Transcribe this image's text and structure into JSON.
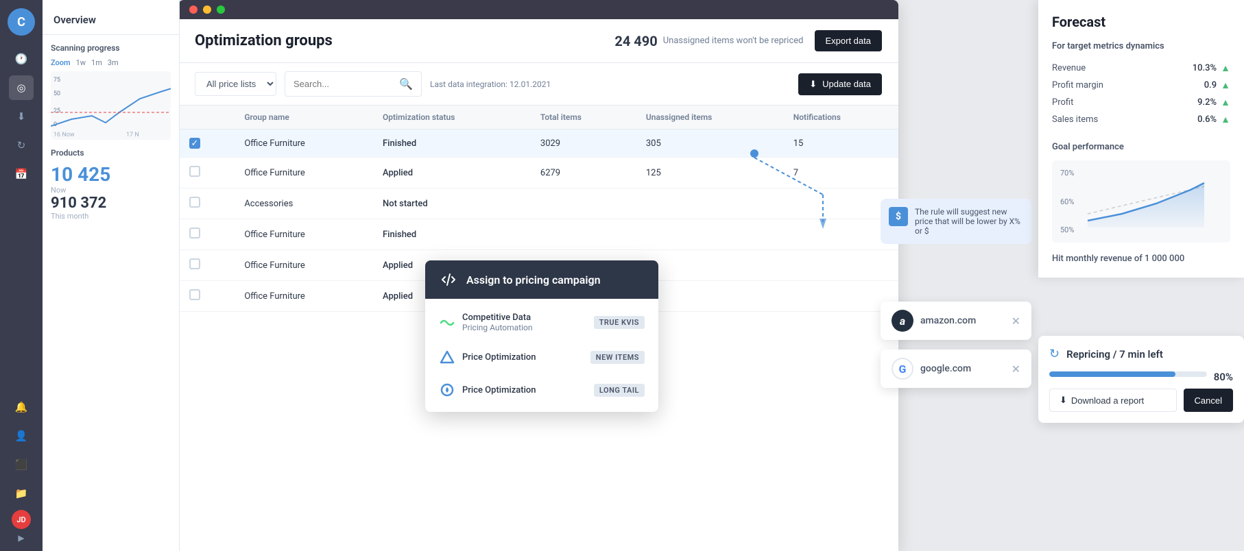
{
  "sidebar": {
    "logo": "C",
    "avatar_initials": "JD",
    "nav_items": [
      {
        "icon": "🕐",
        "name": "history-icon",
        "active": false
      },
      {
        "icon": "◎",
        "name": "target-icon",
        "active": true
      },
      {
        "icon": "⬇",
        "name": "download-icon",
        "active": false
      },
      {
        "icon": "↻",
        "name": "refresh-icon",
        "active": false
      },
      {
        "icon": "📅",
        "name": "calendar-icon",
        "active": false
      }
    ],
    "bottom_items": [
      {
        "icon": "🔔",
        "name": "bell-icon"
      },
      {
        "icon": "👤",
        "name": "user-icon"
      },
      {
        "icon": "⬛",
        "name": "grid-icon"
      },
      {
        "icon": "📁",
        "name": "folder-icon"
      }
    ]
  },
  "overview": {
    "title": "Overview",
    "scanning_progress": "Scanning progress",
    "zoom_options": [
      "Zoom",
      "1w",
      "1m",
      "3m"
    ],
    "chart_labels": [
      "16 Now",
      "17 N"
    ],
    "products_title": "Products",
    "big_number": "10 425",
    "big_number_label": "Now",
    "sub_number": "910 372",
    "sub_number_label": "This month"
  },
  "opt_panel": {
    "title": "Optimization groups",
    "unassigned_count": "24 490",
    "unassigned_text": "Unassigned items won't be repriced",
    "export_btn": "Export data",
    "toolbar": {
      "price_list_label": "All price lists",
      "search_placeholder": "Search...",
      "last_integration": "Last data integration: 12.01.2021",
      "update_btn": "Update data"
    },
    "table": {
      "columns": [
        "",
        "Group name",
        "Optimization status",
        "Total items",
        "Unassigned items",
        "Notifications"
      ],
      "rows": [
        {
          "checked": true,
          "name": "Office Furniture",
          "status": "Finished",
          "total": "3029",
          "unassigned": "305",
          "notifications": "15",
          "selected": true
        },
        {
          "checked": false,
          "name": "Office Furniture",
          "status": "Applied",
          "total": "6279",
          "unassigned": "125",
          "notifications": "7",
          "selected": false
        },
        {
          "checked": false,
          "name": "Accessories",
          "status": "Not started",
          "total": "",
          "unassigned": "",
          "notifications": "",
          "selected": false
        },
        {
          "checked": false,
          "name": "Office Furniture",
          "status": "Finished",
          "total": "",
          "unassigned": "",
          "notifications": "",
          "selected": false
        },
        {
          "checked": false,
          "name": "Office Furniture",
          "status": "Applied",
          "total": "",
          "unassigned": "",
          "notifications": "",
          "selected": false
        },
        {
          "checked": false,
          "name": "Office Furniture",
          "status": "Applied",
          "total": "",
          "unassigned": "",
          "notifications": "",
          "selected": false
        }
      ]
    }
  },
  "assign_popup": {
    "title": "Assign to pricing campaign",
    "icon": "⇄",
    "items": [
      {
        "icon_type": "wave",
        "text_line1": "Competitive Data",
        "text_line2": "Pricing Automation",
        "tag": "TRUE KVIS",
        "color": "#4ade80"
      },
      {
        "icon_type": "triangle",
        "text_line1": "Price Optimization",
        "tag": "NEW ITEMS",
        "color": "#4a90d9"
      },
      {
        "icon_type": "circle",
        "text_line1": "Price Optimization",
        "tag": "LONG TAIL",
        "color": "#4a90d9"
      }
    ]
  },
  "forecast": {
    "title": "Forecast",
    "subtitle": "For target metrics dynamics",
    "metrics": [
      {
        "label": "Revenue",
        "value": "10.3%",
        "trend": "up"
      },
      {
        "label": "Profit margin",
        "value": "0.9",
        "trend": "up"
      },
      {
        "label": "Profit",
        "value": "9.2%",
        "trend": "up"
      },
      {
        "label": "Sales items",
        "value": "0.6%",
        "trend": "up"
      }
    ],
    "goal_performance": "Goal performance",
    "chart_y_labels": [
      "70%",
      "60%",
      "50%"
    ],
    "hit_revenue": "Hit monthly revenue of 1 000 000"
  },
  "repricing": {
    "title": "Repricing / 7 min left",
    "progress": 80,
    "progress_text": "80%",
    "download_btn": "Download a report",
    "cancel_btn": "Cancel"
  },
  "competitors": [
    {
      "name": "amazon.com",
      "logo": "a"
    },
    {
      "name": "google.com",
      "logo": "G"
    }
  ],
  "rule_panel": {
    "text": "The rule will suggest new price that will be lower by X% or $",
    "icon": "$"
  }
}
